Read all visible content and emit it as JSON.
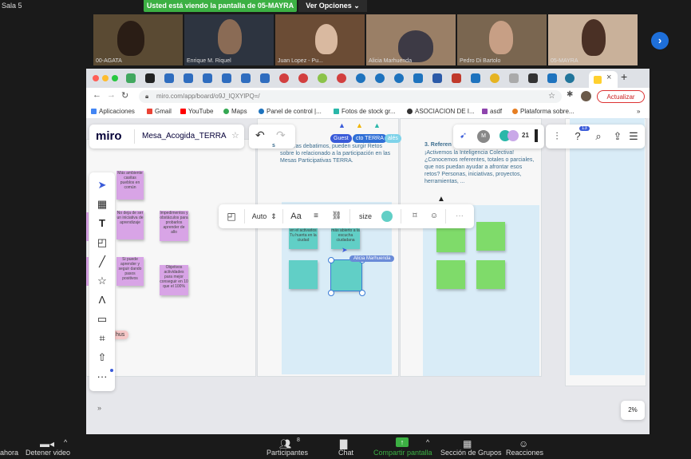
{
  "zoom": {
    "room": "Sala 5",
    "share_banner": "Usted está viendo la pantalla de 05-MAYRA",
    "view_options": "Ver Opciones",
    "participants": [
      {
        "name": "00-AGATA"
      },
      {
        "name": "Enrique M. Riquel"
      },
      {
        "name": "Juan Lopez - Pu..."
      },
      {
        "name": "Alicia Marhuenda"
      },
      {
        "name": "Pedro Di Bartolo"
      },
      {
        "name": "05-MAYRA"
      }
    ],
    "bottom_bar": {
      "left_partial": "ahora",
      "stop_video": "Detener video",
      "participants_label": "Participantes",
      "participants_count": "8",
      "chat": "Chat",
      "share_screen": "Compartir pantalla",
      "breakout_rooms": "Sección de Grupos",
      "reactions": "Reacciones"
    }
  },
  "browser": {
    "url": "miro.com/app/board/o9J_lQXYlPQ=/",
    "update_button": "Actualizar",
    "bookmarks": [
      {
        "label": "Aplicaciones",
        "color": "#4285f4"
      },
      {
        "label": "Gmail",
        "color": "#ea4335"
      },
      {
        "label": "YouTube",
        "color": "#ff0000"
      },
      {
        "label": "Maps",
        "color": "#34a853"
      },
      {
        "label": "Panel de control |...",
        "color": "#1e73be"
      },
      {
        "label": "Fotos de stock gr...",
        "color": "#2ab7a9"
      },
      {
        "label": "ASOCIACION DE I...",
        "color": "#333333"
      },
      {
        "label": "asdf",
        "color": "#8e44ad"
      },
      {
        "label": "Plataforma sobre...",
        "color": "#e67e22"
      }
    ],
    "more_bookmarks": "»"
  },
  "miro": {
    "logo": "miro",
    "board_name": "Mesa_Acogida_TERRA",
    "guest_label": "Guest",
    "board_chip": "cto TERRA",
    "board_chip_suffix": "alés",
    "collaborators_count": "21",
    "notifications": "13",
    "zoom_level": "2%",
    "frame1_heading": "s",
    "frame1_text": "Mientras debatimos, pueden surgir Retos sobre lo relacionado a la participación en las Mesas Participativas TERRA.",
    "frame2_heading": "3. Referen",
    "frame2_text": "¡Activemos la Inteligencia Colectiva! ¿Conocemos referentes, totales o parciales, que nos puedan ayudar a afrontar esos retos? Personas, iniciativas, proyectos, herramientas, ...",
    "cursor_label": "Alicia Marhuenda",
    "left_chip": "hus",
    "float_toolbar": {
      "auto": "Auto",
      "font": "Aa",
      "size": "size",
      "more": "···"
    },
    "pink_stickies": [
      "Más ambiente casitas pueblos en común",
      "No deja de ser un iniciativa de aprendizaje",
      "Impedimentos y obstáculos para probarlos aprender de allo",
      "Si puede aprender y seguir dando pasos positivos",
      "Objetivos actividades para mejor conseguir en 10 que el 100%"
    ],
    "teal_stickies": [
      "en el activarlos Tu huerta en la ciudad",
      "más abierto a la escucha ciudadana"
    ]
  }
}
